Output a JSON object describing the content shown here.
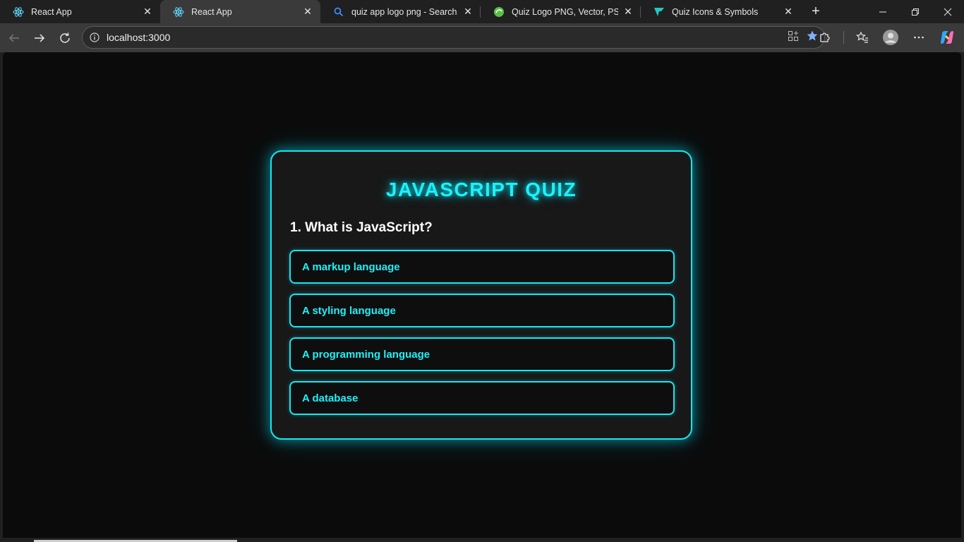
{
  "browser": {
    "tabs": [
      {
        "title": "React App",
        "icon": "react-icon",
        "active": false
      },
      {
        "title": "React App",
        "icon": "react-icon",
        "active": true
      },
      {
        "title": "quiz app logo png - Search",
        "icon": "search-icon",
        "active": false
      },
      {
        "title": "Quiz Logo PNG, Vector, PSD, and",
        "icon": "site-favicon-icon",
        "active": false
      },
      {
        "title": "Quiz Icons & Symbols",
        "icon": "site-favicon-icon",
        "active": false
      }
    ],
    "address": {
      "url": "localhost:3000"
    },
    "accent_color": "#19e6f0"
  },
  "quiz": {
    "title": "JAVASCRIPT QUIZ",
    "question": "1. What is JavaScript?",
    "options": [
      "A markup language",
      "A styling language",
      "A programming language",
      "A database"
    ]
  }
}
